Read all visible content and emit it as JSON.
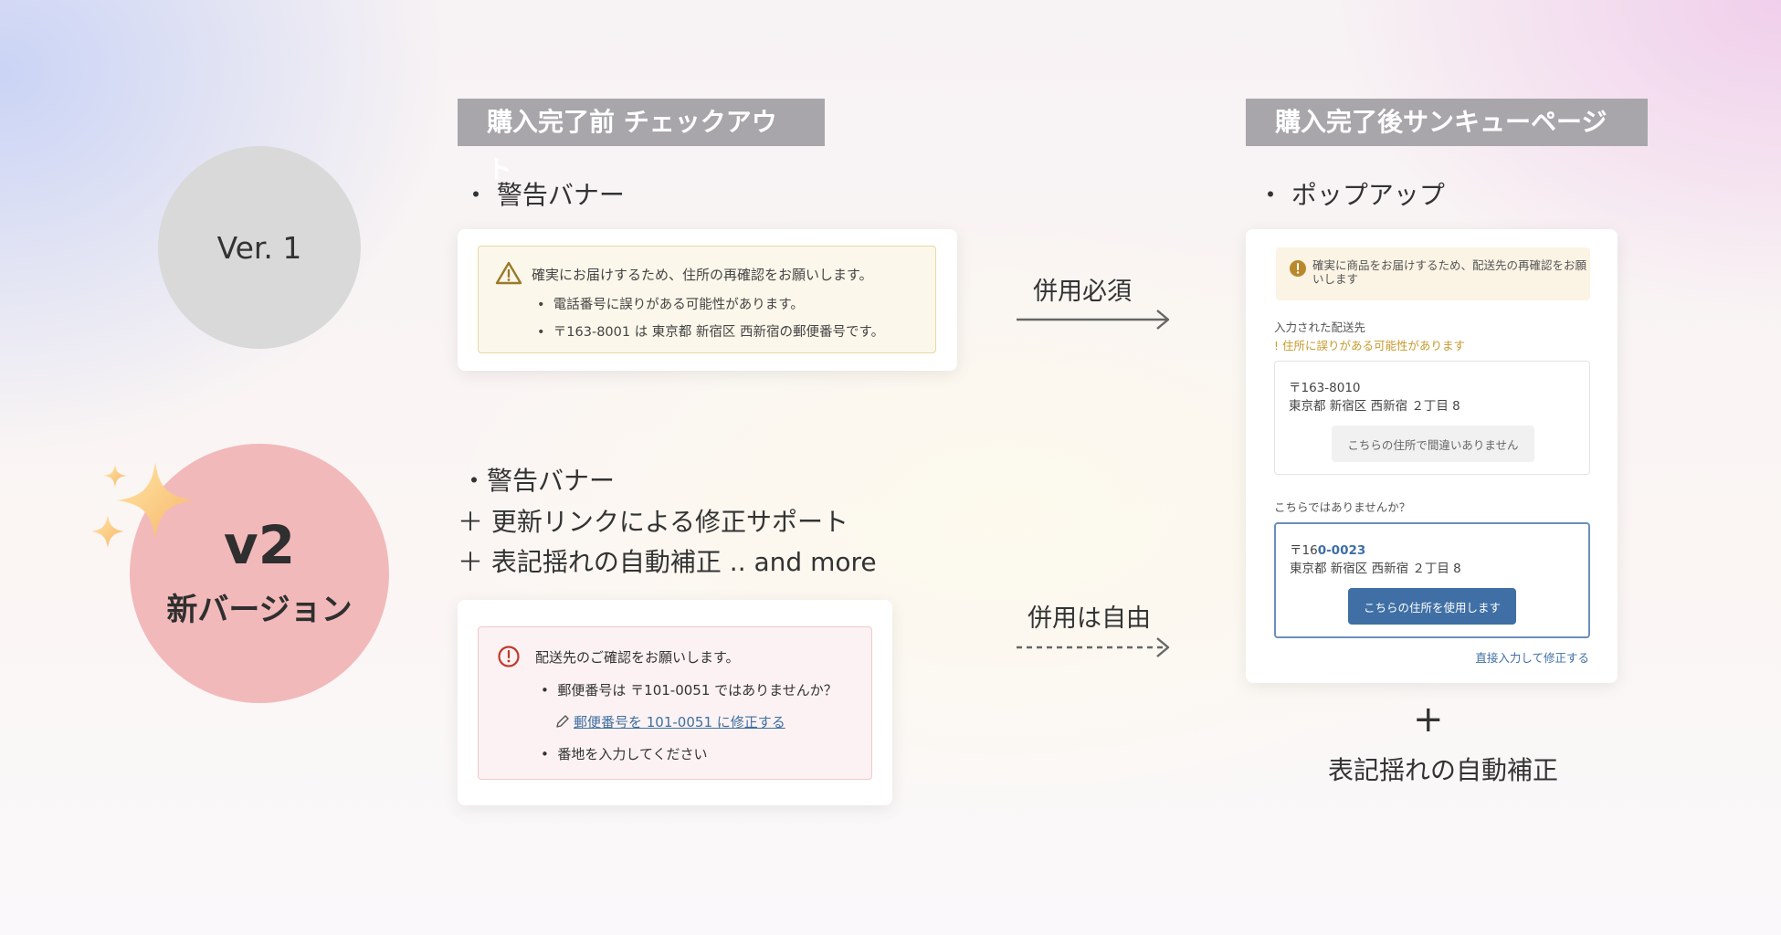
{
  "ver1": {
    "label": "Ver. 1"
  },
  "v2": {
    "title": "v2",
    "subtitle": "新バージョン"
  },
  "headers": {
    "left": "購入完了前 チェックアウト",
    "right": "購入完了後サンキューページ"
  },
  "ver1_feature": "・ 警告バナー",
  "v2_features": [
    "・警告バナー",
    "＋ 更新リンクによる修正サポート",
    "＋ 表記揺れの自動補正 .. and more"
  ],
  "popup_feature": "・ ポップアップ",
  "v1_banner": {
    "message": "確実にお届けするため、住所の再確認をお願いします。",
    "items": [
      "電話番号に誤りがある可能性があります。",
      "〒163-8001 は 東京都 新宿区 西新宿の郵便番号です。"
    ]
  },
  "v2_banner": {
    "message": "配送先のご確認をお願いします。",
    "item1": "郵便番号は 〒101-0051 ではありませんか？",
    "link": "郵便番号を 101-0051 に修正する",
    "item2": "番地を入力してください"
  },
  "arrows": {
    "required": "併用必須",
    "optional": "併用は自由"
  },
  "popup": {
    "banner": "確実に商品をお届けするため、配送先の再確認をお願いします",
    "entered_label": "入力された配送先",
    "warning": "! 住所に誤りがある可能性があります",
    "entered_zip": "〒163-8010",
    "entered_address": "東京都 新宿区 西新宿 ２丁目 8",
    "keep_button": "こちらの住所で間違いありません",
    "suggest_label": "こちらではありませんか？",
    "suggest_zip_prefix": "〒16",
    "suggest_zip_highlight": "0-0023",
    "suggest_address": "東京都 新宿区 西新宿 ２丁目 8",
    "use_button": "こちらの住所を使用します",
    "edit_link": "直接入力して修正する"
  },
  "bottom": {
    "plus": "+",
    "label": "表記揺れの自動補正"
  },
  "colors": {
    "warning_icon": "#9a7a2a",
    "error_icon": "#c0392b",
    "link": "#3f6f9f",
    "primary_button": "#3f6fa5",
    "warning_text": "#c69a2c",
    "v2_circle": "#f2b9ba",
    "v1_circle": "#d9d9d9"
  }
}
